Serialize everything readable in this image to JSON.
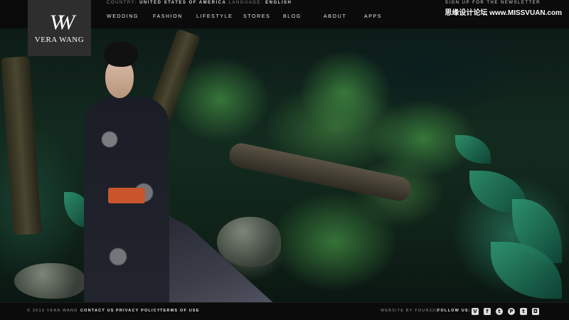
{
  "header": {
    "logo_text": "VERA WANG",
    "logo_mark": "VW",
    "country_label": "COUNTRY:",
    "country_value": "UNITED STATES OF AMERICA",
    "language_label": "LANGUAGE:",
    "language_value": "ENGLISH",
    "newsletter": "SIGN UP FOR THE NEWSLETTER",
    "watermark": "思缘设计论坛 www.MISSVUAN.com",
    "nav": [
      "WEDDING",
      "FASHION",
      "LIFESTYLE",
      "STORES",
      "BLOG",
      "ABOUT",
      "APPS"
    ]
  },
  "footer": {
    "copyright": "© 2013 VERA WANG",
    "contact": "CONTACT US",
    "privacy": "PRIVACY POLICY",
    "terms": "TERMS OF USE",
    "credit": "WEBSITE BY FOUR32C",
    "follow": "FOLLOW US:",
    "social": [
      {
        "name": "vimeo-icon",
        "glyph": "V"
      },
      {
        "name": "facebook-icon",
        "glyph": "f"
      },
      {
        "name": "twitter-icon",
        "glyph": "t"
      },
      {
        "name": "pinterest-icon",
        "glyph": "P"
      },
      {
        "name": "tumblr-icon",
        "glyph": "t"
      },
      {
        "name": "instagram-icon",
        "glyph": "◘"
      }
    ]
  },
  "colors": {
    "bar": "#0b0b0b",
    "logo_bg": "#2e2e2e",
    "accent_belt": "#c8552c"
  }
}
